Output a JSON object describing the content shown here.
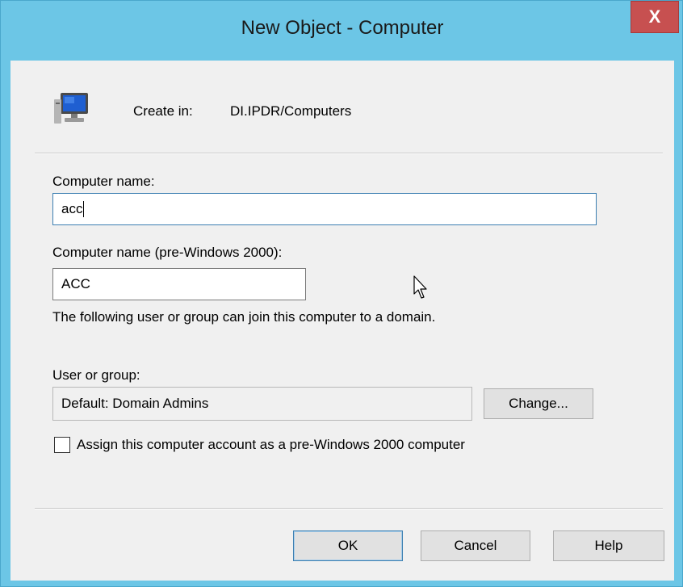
{
  "window": {
    "title": "New Object - Computer",
    "close_label": "X"
  },
  "header": {
    "icon": "computer-icon",
    "create_in_label": "Create in:",
    "create_in_value": "DI.IPDR/Computers"
  },
  "form": {
    "computer_name_label": "Computer name:",
    "computer_name_value": "acc",
    "pre2000_label": "Computer name (pre-Windows 2000):",
    "pre2000_value": "ACC",
    "info_text": "The following user or group can join this computer to a domain.",
    "user_group_label": "User or group:",
    "user_group_value": "Default: Domain Admins",
    "change_button": "Change...",
    "checkbox_label": "Assign this computer account as a pre-Windows 2000 computer",
    "checkbox_checked": false
  },
  "buttons": {
    "ok": "OK",
    "cancel": "Cancel",
    "help": "Help"
  },
  "colors": {
    "titlebar": "#6cc6e6",
    "close": "#c75050",
    "dialog_bg": "#f0f0f0"
  }
}
